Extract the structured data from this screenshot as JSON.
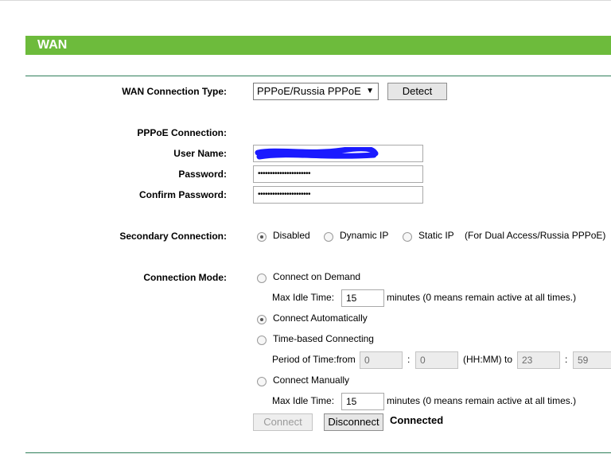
{
  "section": {
    "title": "WAN"
  },
  "form": {
    "wan_type": {
      "label": "WAN Connection Type:",
      "value": "PPPoE/Russia PPPoE",
      "detect_label": "Detect"
    },
    "pppoe_heading": "PPPoE Connection:",
    "username": {
      "label": "User Name:",
      "value": ""
    },
    "password": {
      "label": "Password:",
      "value": "••••••••••••••••••••••"
    },
    "confirm_password": {
      "label": "Confirm Password:",
      "value": "••••••••••••••••••••••"
    },
    "secondary": {
      "label": "Secondary Connection:",
      "options": [
        {
          "label": "Disabled",
          "selected": true
        },
        {
          "label": "Dynamic IP",
          "selected": false
        },
        {
          "label": "Static IP",
          "selected": false
        }
      ],
      "note": "(For Dual Access/Russia PPPoE)"
    },
    "mode": {
      "label": "Connection Mode:",
      "on_demand": {
        "label": "Connect on Demand",
        "selected": false
      },
      "idle1": {
        "label": "Max Idle Time:",
        "value": "15",
        "suffix": "minutes (0 means remain active at all times.)"
      },
      "automatic": {
        "label": "Connect Automatically",
        "selected": true
      },
      "time_based": {
        "label": "Time-based Connecting",
        "selected": false
      },
      "period": {
        "label": "Period of Time:from",
        "from_h": "0",
        "sep1": ":",
        "from_m": "0",
        "format_to": "(HH:MM) to",
        "to_h": "23",
        "sep2": ":",
        "to_m": "59"
      },
      "manual": {
        "label": "Connect Manually",
        "selected": false
      },
      "idle2": {
        "label": "Max Idle Time:",
        "value": "15",
        "suffix": "minutes (0 means remain active at all times.)"
      }
    },
    "connect_label": "Connect",
    "disconnect_label": "Disconnect",
    "status": "Connected"
  },
  "colors": {
    "banner": "#6dbb3c",
    "divider": "#2f7f5a",
    "redaction": "#1a1aff"
  }
}
